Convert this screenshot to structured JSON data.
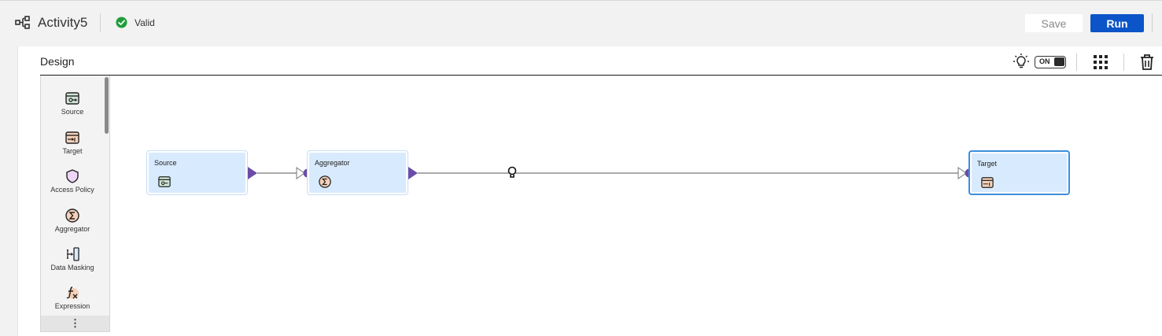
{
  "header": {
    "title": "Activity5",
    "status": "Valid",
    "save_label": "Save",
    "run_label": "Run",
    "accent": "#0b55c8",
    "valid_color": "#1e9e3a"
  },
  "design": {
    "label": "Design",
    "toggle_label": "ON",
    "icons": [
      "lightbulb-icon",
      "grid-icon",
      "trash-icon"
    ]
  },
  "palette": {
    "items": [
      {
        "label": "Source",
        "icon": "source-icon"
      },
      {
        "label": "Target",
        "icon": "target-icon"
      },
      {
        "label": "Access Policy",
        "icon": "shield-icon"
      },
      {
        "label": "Aggregator",
        "icon": "sigma-icon"
      },
      {
        "label": "Data Masking",
        "icon": "data-masking-icon"
      },
      {
        "label": "Expression",
        "icon": "expression-icon"
      }
    ],
    "more": "⋮"
  },
  "canvas": {
    "nodes": [
      {
        "title": "Source",
        "icon": "source-icon"
      },
      {
        "title": "Aggregator",
        "icon": "sigma-icon"
      },
      {
        "title": "Target",
        "icon": "target-icon",
        "selected": true
      }
    ],
    "node_fill": "#d8eafd",
    "port_color": "#6b4ba8"
  }
}
